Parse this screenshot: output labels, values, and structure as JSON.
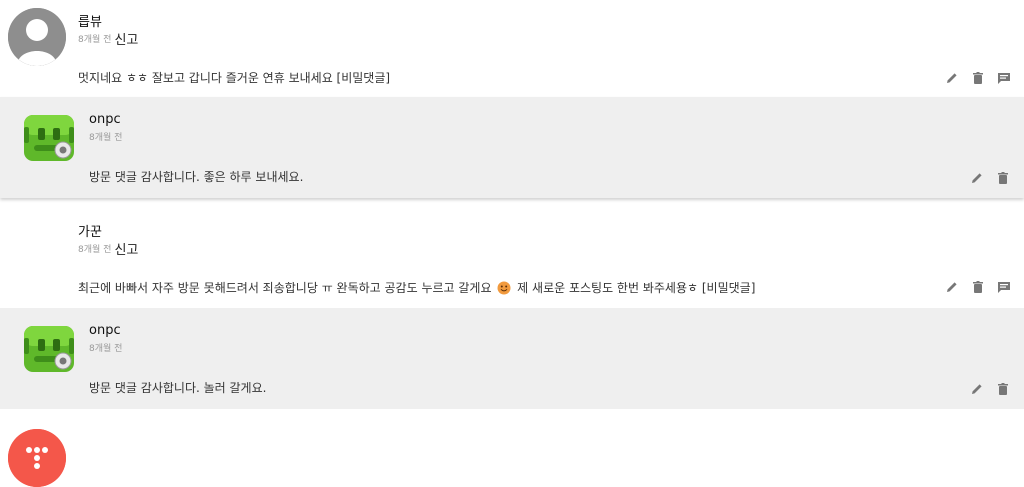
{
  "comments": [
    {
      "author": "릅뷰",
      "time": "8개월 전",
      "report": "신고",
      "text": "멋지네요 ㅎㅎ 잘보고 갑니다 즐거운 연휴 보내세요 ",
      "secret": "[비밀댓글]",
      "reply": {
        "author": "onpc",
        "time": "8개월 전",
        "text": "방문 댓글 감사합니다. 좋은 하루 보내세요."
      }
    },
    {
      "author": "가꾼",
      "time": "8개월 전",
      "report": "신고",
      "text_before": "최근에 바빠서 자주 방문 못해드려서 죄송합니당 ㅠ 완독하고 공감도 누르고 갈게요",
      "text_after": " 제 새로운 포스팅도 한번 봐주세용ㅎ ",
      "secret": "[비밀댓글]",
      "reply": {
        "author": "onpc",
        "time": "8개월 전",
        "text": "방문 댓글 감사합니다. 놀러 갈게요."
      }
    }
  ],
  "icons": {
    "edit": "pencil-icon",
    "delete": "trash-icon",
    "reply": "comment-icon"
  },
  "colors": {
    "reply_bg": "#efefef",
    "icon": "#777777",
    "kakao_avatar": "#f4574a",
    "onpc_avatar": "#5fb82a"
  }
}
